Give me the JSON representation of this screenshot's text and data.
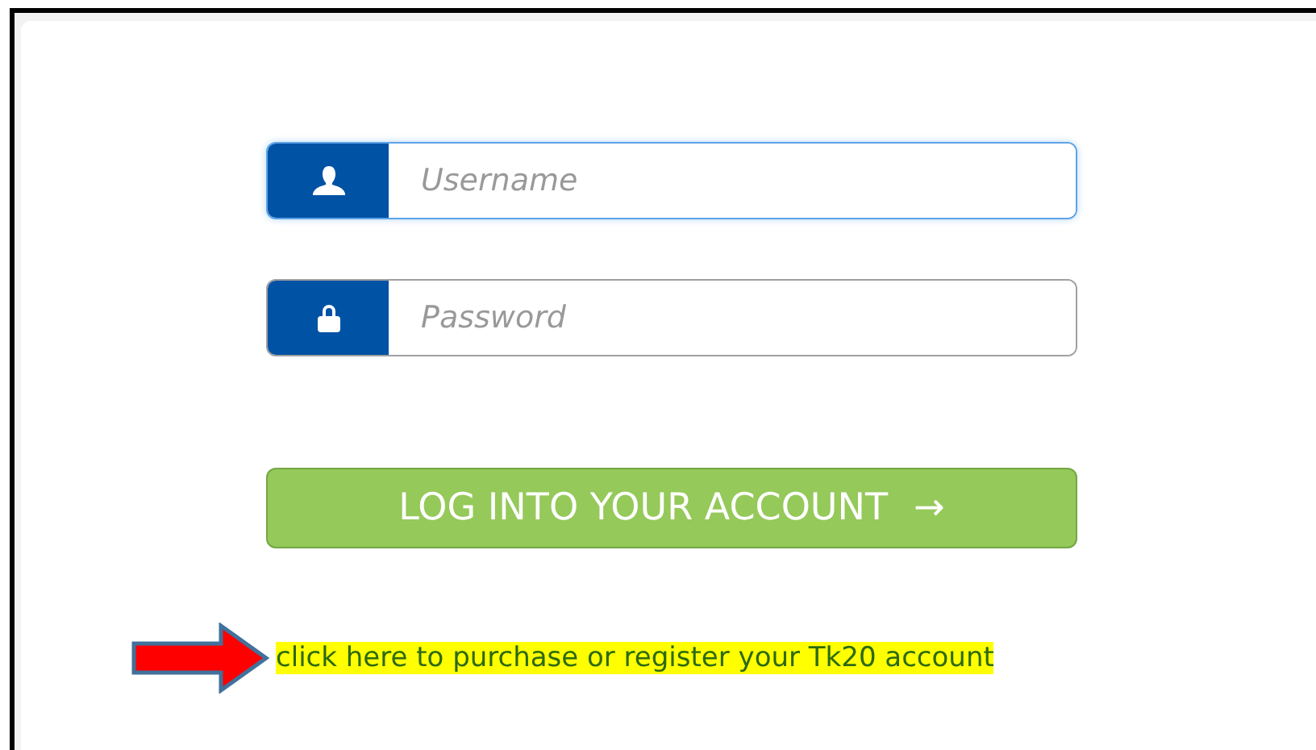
{
  "fields": [
    {
      "kind": "user",
      "placeholder": "Username",
      "focused": true
    },
    {
      "kind": "lock",
      "placeholder": "Password",
      "focused": false
    }
  ],
  "login_button": {
    "label": "LOG INTO YOUR ACCOUNT",
    "icon": "→"
  },
  "register_link": {
    "text": "click here to purchase or register your Tk20 account",
    "highlighted": true
  }
}
